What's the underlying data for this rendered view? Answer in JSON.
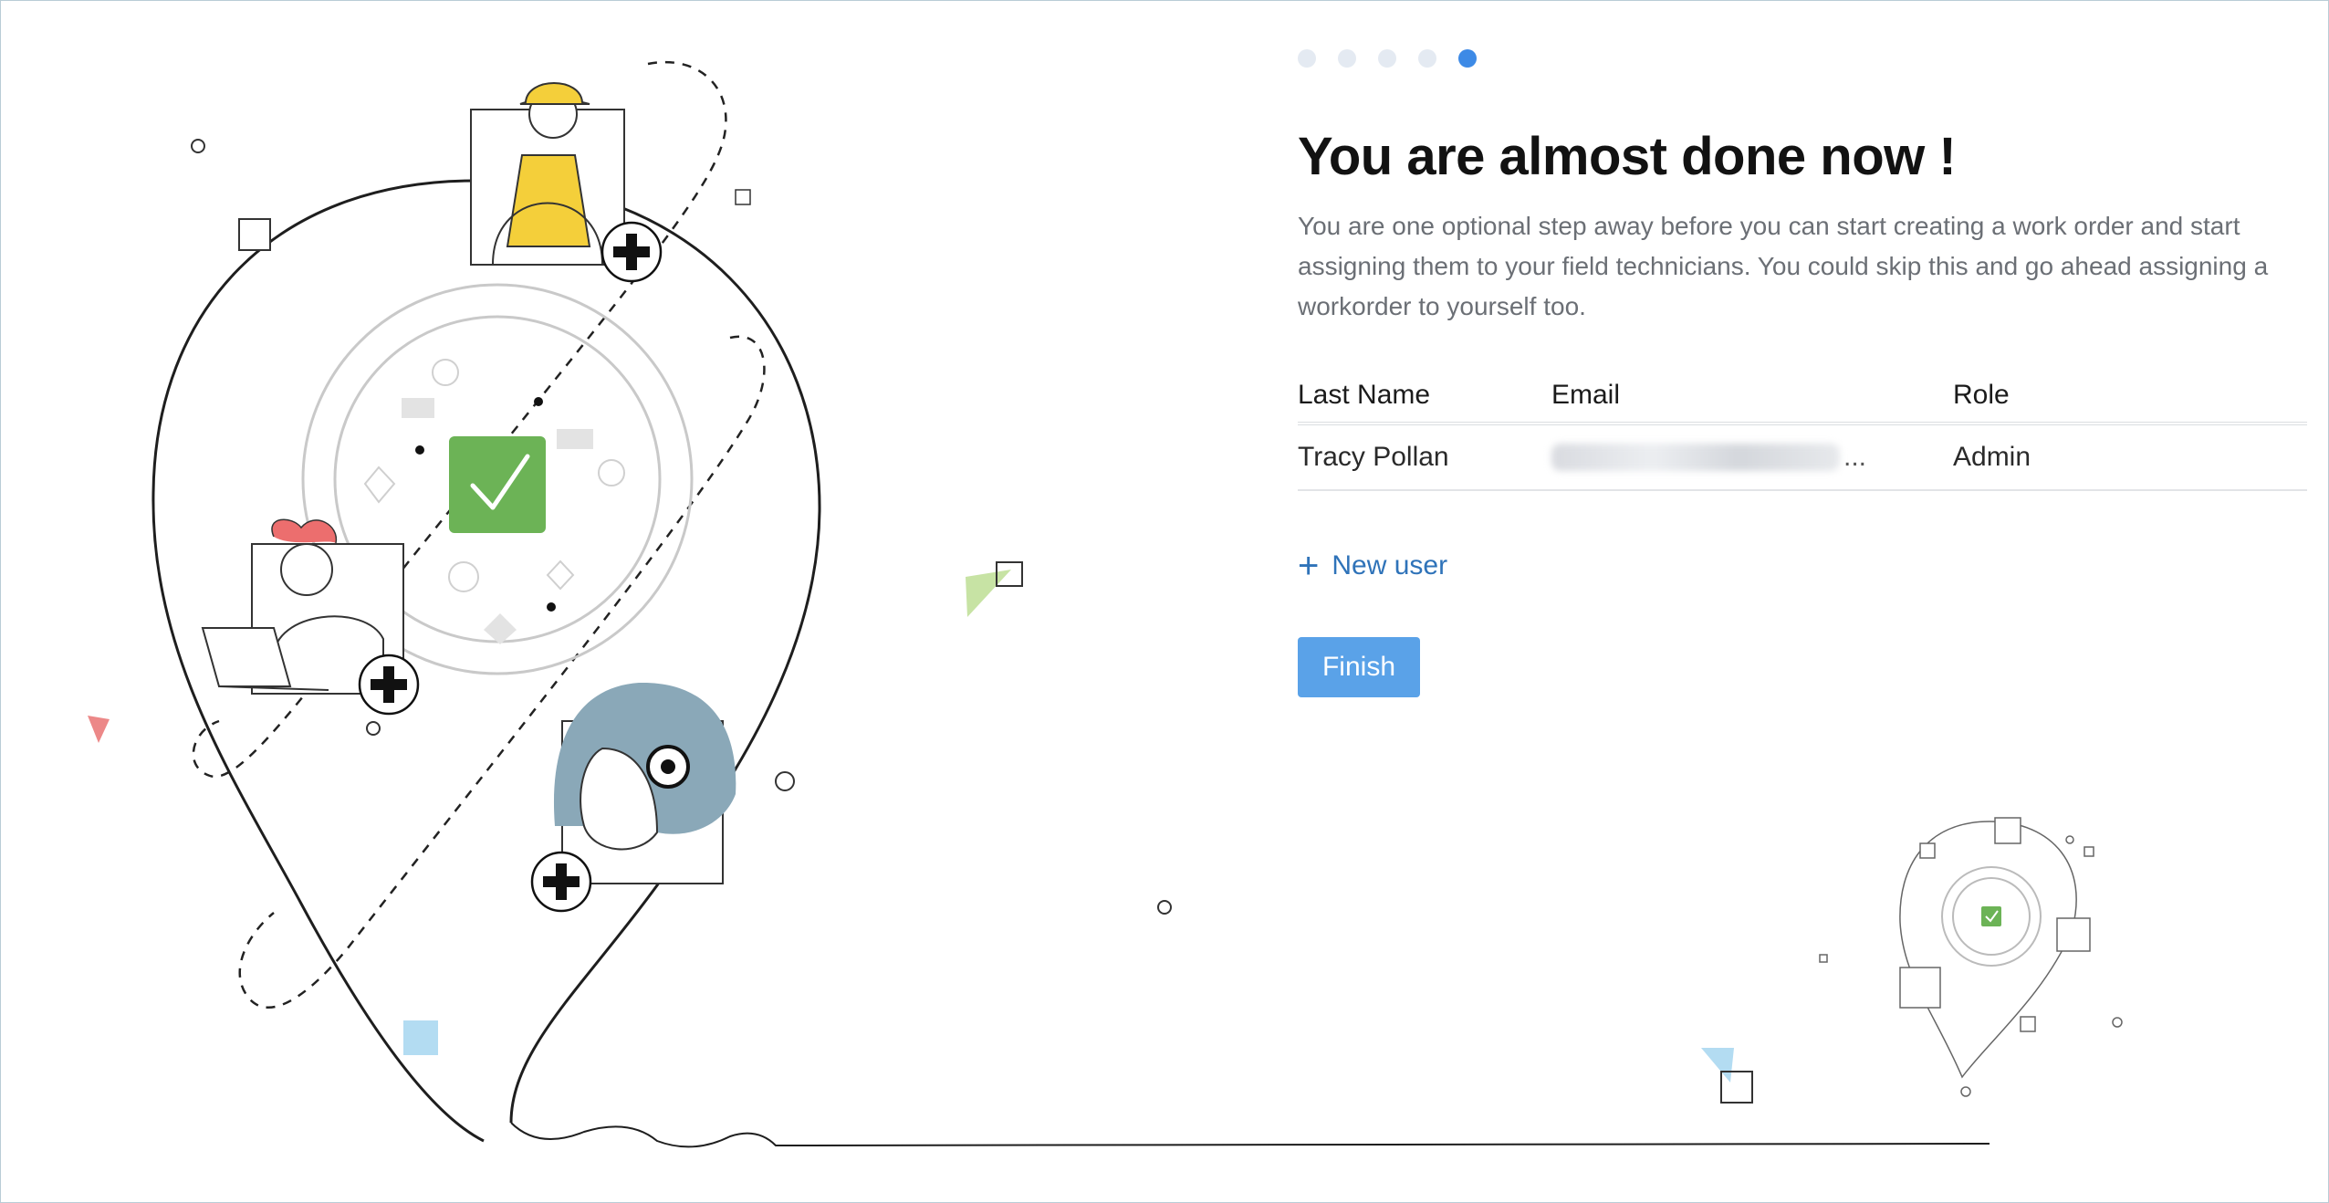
{
  "stepper": {
    "total_steps": 5,
    "current_step": 5
  },
  "heading": {
    "title": "You are almost done now !",
    "subtitle": "You are one optional step away before you can start creating a work order and start assigning them to your field technicians. You could skip this and go ahead assigning a workorder to yourself too."
  },
  "table": {
    "columns": [
      "Last Name",
      "Email",
      "Role"
    ],
    "rows": [
      {
        "last_name": "Tracy Pollan",
        "email_suffix": "...",
        "role": "Admin"
      }
    ]
  },
  "actions": {
    "new_user_label": "New user",
    "finish_label": "Finish"
  },
  "colors": {
    "accent": "#3d8ae6",
    "button": "#5aa2e8",
    "link": "#2f73b9",
    "check_green": "#6cb356",
    "hat_yellow": "#f4cf3a",
    "hair_red": "#ec6e6e",
    "hair_blue": "#8aa8b8"
  },
  "icons": [
    "check-icon",
    "plus-icon",
    "medical-cross-icon"
  ]
}
